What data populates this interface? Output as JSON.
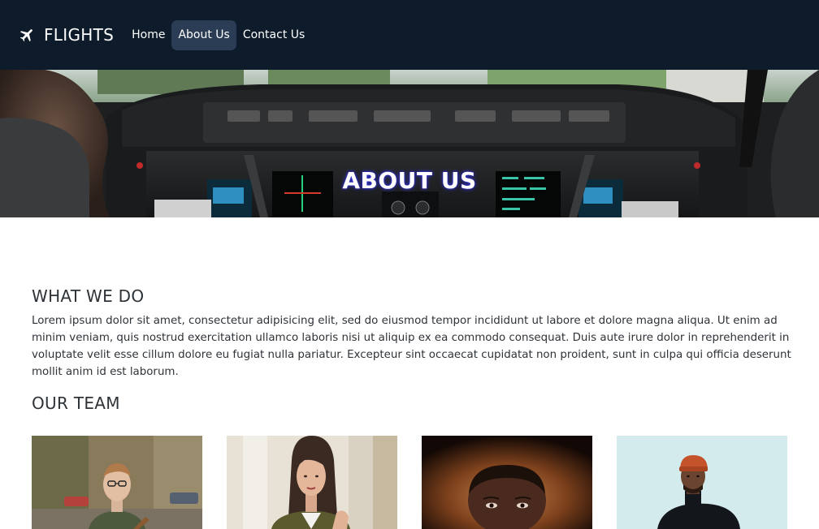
{
  "nav": {
    "brand": "FLIGHTS",
    "links": [
      "Home",
      "About Us",
      "Contact Us"
    ],
    "active": "About Us"
  },
  "hero": {
    "title": "ABOUT US"
  },
  "what_we_do": {
    "heading": "WHAT WE DO",
    "text": "Lorem ipsum dolor sit amet, consectetur adipisicing elit, sed do eiusmod tempor incididunt ut labore et dolore magna aliqua. Ut enim ad minim veniam, quis nostrud exercitation ullamco laboris nisi ut aliquip ex ea commodo consequat. Duis aute irure dolor in reprehenderit in voluptate velit esse cillum dolore eu fugiat nulla pariatur. Excepteur sint occaecat cupidatat non proident, sunt in culpa qui officia deserunt mollit anim id est laborum."
  },
  "our_team": {
    "heading": "OUR TEAM"
  },
  "colors": {
    "navbar": "#0d1b2a",
    "active_link": "#2a3d54",
    "text": "#2e3338"
  },
  "icons": {
    "brand": "airplane-icon"
  }
}
